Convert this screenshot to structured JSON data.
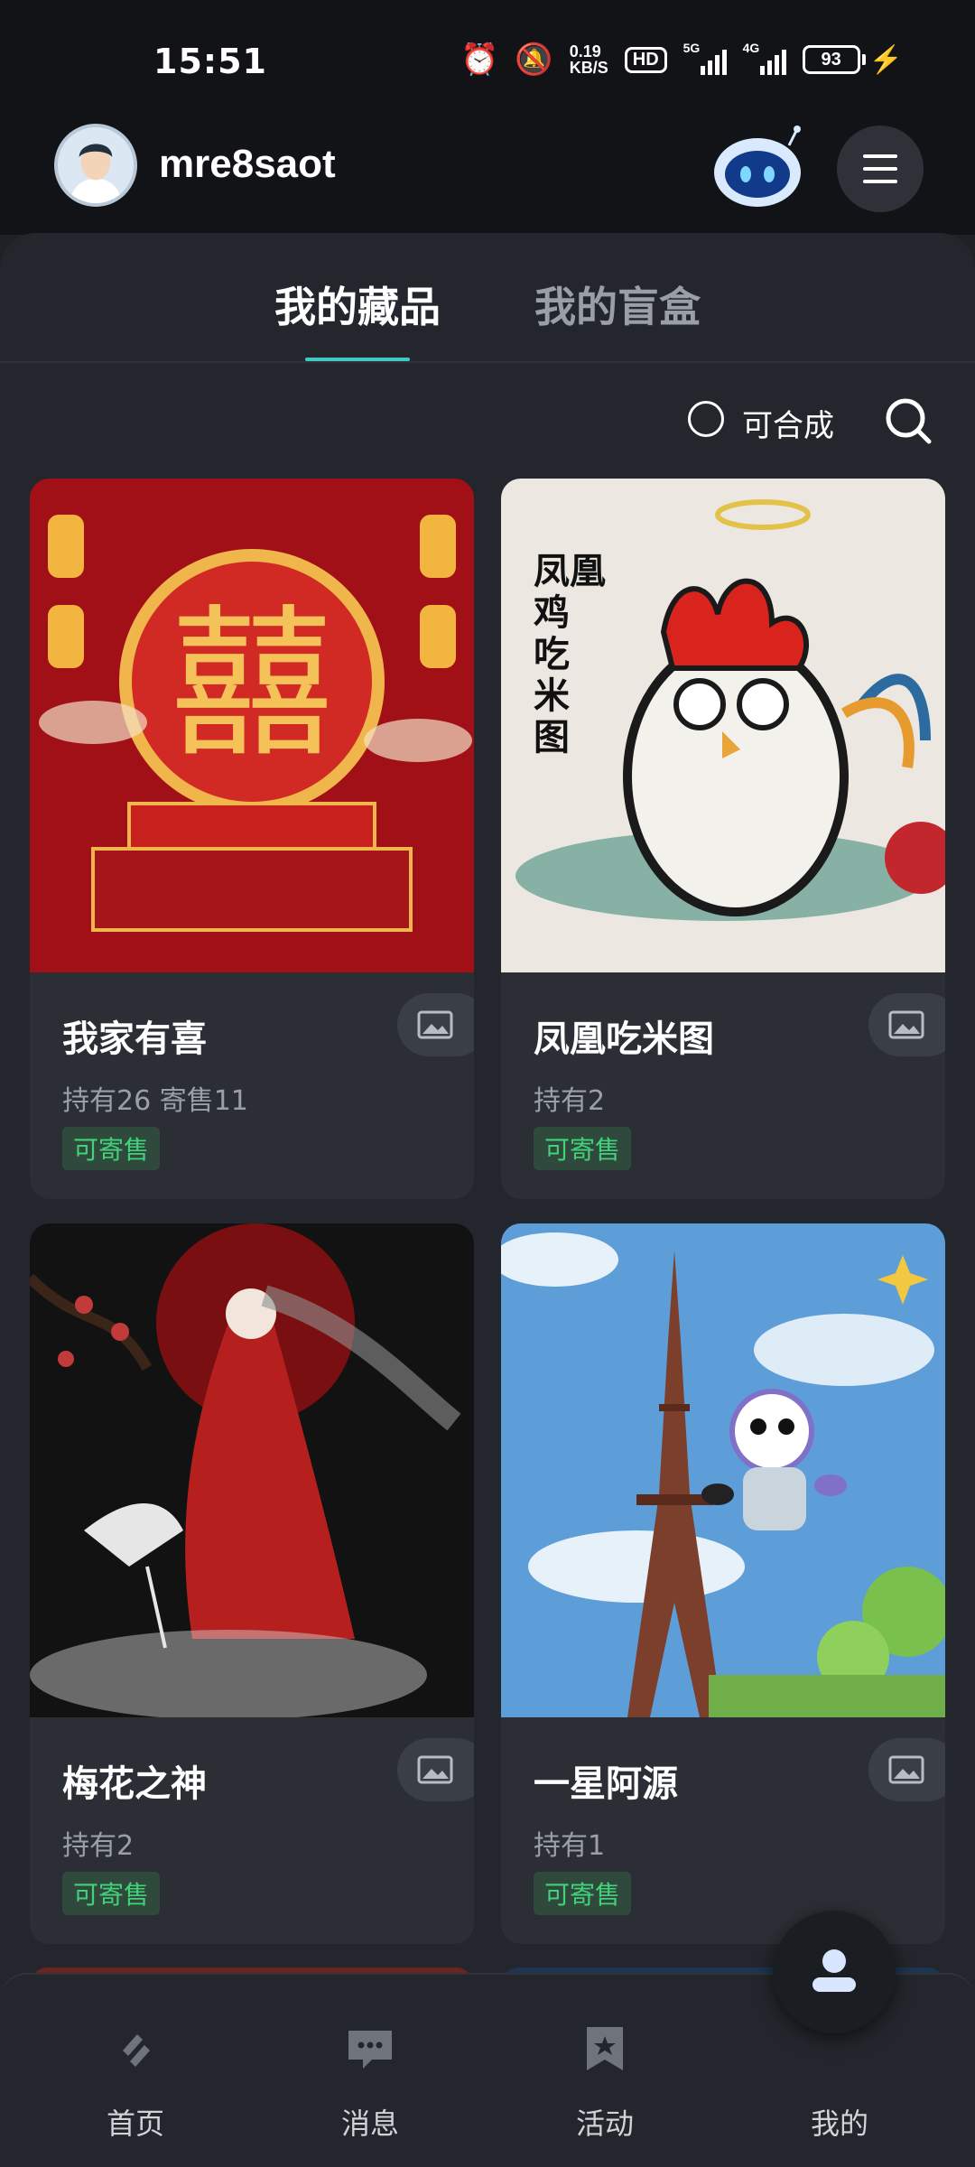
{
  "status_bar": {
    "time": "15:51",
    "net_speed_value": "0.19",
    "net_speed_unit": "KB/S",
    "hd_badge": "HD",
    "sim1_tag": "5G",
    "sim2_tag": "4G",
    "battery": "93"
  },
  "header": {
    "username": "mre8saot"
  },
  "tabs": [
    {
      "label": "我的藏品"
    },
    {
      "label": "我的盲盒"
    }
  ],
  "tools": {
    "synth_label": "可合成"
  },
  "cards": [
    {
      "title": "我家有喜",
      "meta": "持有26  寄售11",
      "tag": "可寄售"
    },
    {
      "title": "凤凰吃米图",
      "meta": "持有2",
      "tag": "可寄售"
    },
    {
      "title": "梅花之神",
      "meta": "持有2",
      "tag": "可寄售"
    },
    {
      "title": "一星阿源",
      "meta": "持有1",
      "tag": "可寄售"
    }
  ],
  "card2_art_text": [
    "凤凰",
    "鸡",
    "吃",
    "米",
    "图"
  ],
  "nav": [
    {
      "label": "首页"
    },
    {
      "label": "消息"
    },
    {
      "label": "活动"
    },
    {
      "label": "我的"
    }
  ],
  "colors": {
    "accent": "#40c9c0",
    "tag_green": "#41d27a",
    "background": "#1e2126"
  }
}
